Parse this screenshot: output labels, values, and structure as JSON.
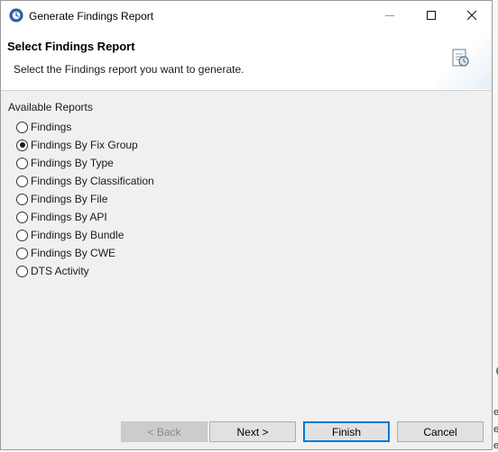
{
  "window": {
    "title": "Generate Findings Report",
    "icon": "app-globe-icon"
  },
  "header": {
    "title": "Select Findings Report",
    "description": "Select the Findings report you want to generate.",
    "icon": "report-document-icon"
  },
  "group": {
    "label": "Available Reports",
    "selected": "Findings By Fix Group",
    "options": [
      {
        "label": "Findings",
        "checked": false
      },
      {
        "label": "Findings By Fix Group",
        "checked": true
      },
      {
        "label": "Findings By Type",
        "checked": false
      },
      {
        "label": "Findings By Classification",
        "checked": false
      },
      {
        "label": "Findings By File",
        "checked": false
      },
      {
        "label": "Findings By API",
        "checked": false
      },
      {
        "label": "Findings By Bundle",
        "checked": false
      },
      {
        "label": "Findings By CWE",
        "checked": false
      },
      {
        "label": "DTS Activity",
        "checked": false
      }
    ]
  },
  "buttons": {
    "back": "< Back",
    "next": "Next >",
    "finish": "Finish",
    "cancel": "Cancel"
  },
  "edge": {
    "letters": [
      "e",
      "e",
      "e"
    ]
  },
  "colors": {
    "accent": "#0078d7",
    "dialog_bg": "#f0f0f0",
    "header_bg": "#ffffff"
  }
}
